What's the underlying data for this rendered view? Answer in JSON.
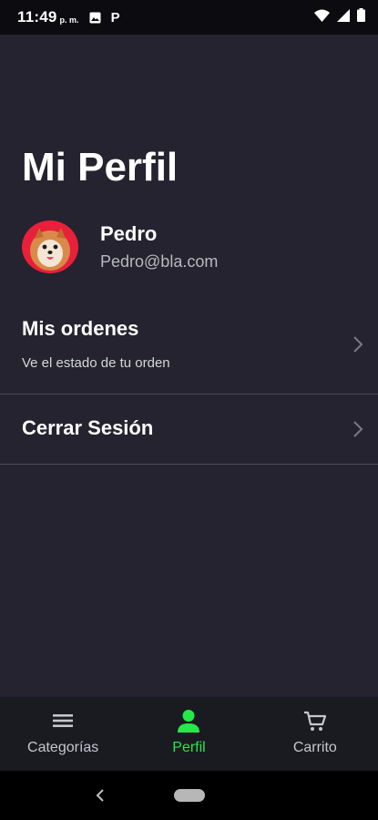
{
  "status_bar": {
    "time": "11:49",
    "ampm": "p. m.",
    "app_icon_letter": "P"
  },
  "page": {
    "title": "Mi Perfil"
  },
  "profile": {
    "name": "Pedro",
    "email": "Pedro@bla.com"
  },
  "menu": [
    {
      "title": "Mis ordenes",
      "subtitle": "Ve el estado de tu orden"
    },
    {
      "title": "Cerrar Sesión"
    }
  ],
  "bottom_nav": {
    "active": "Perfil",
    "items": [
      {
        "label": "Categorías",
        "icon": "menu-icon"
      },
      {
        "label": "Perfil",
        "icon": "person-icon"
      },
      {
        "label": "Carrito",
        "icon": "cart-icon"
      }
    ]
  },
  "colors": {
    "background": "#24232f",
    "accent": "#26e84a",
    "nav_bg": "#1a1a21",
    "avatar_bg": "#e8203a"
  }
}
